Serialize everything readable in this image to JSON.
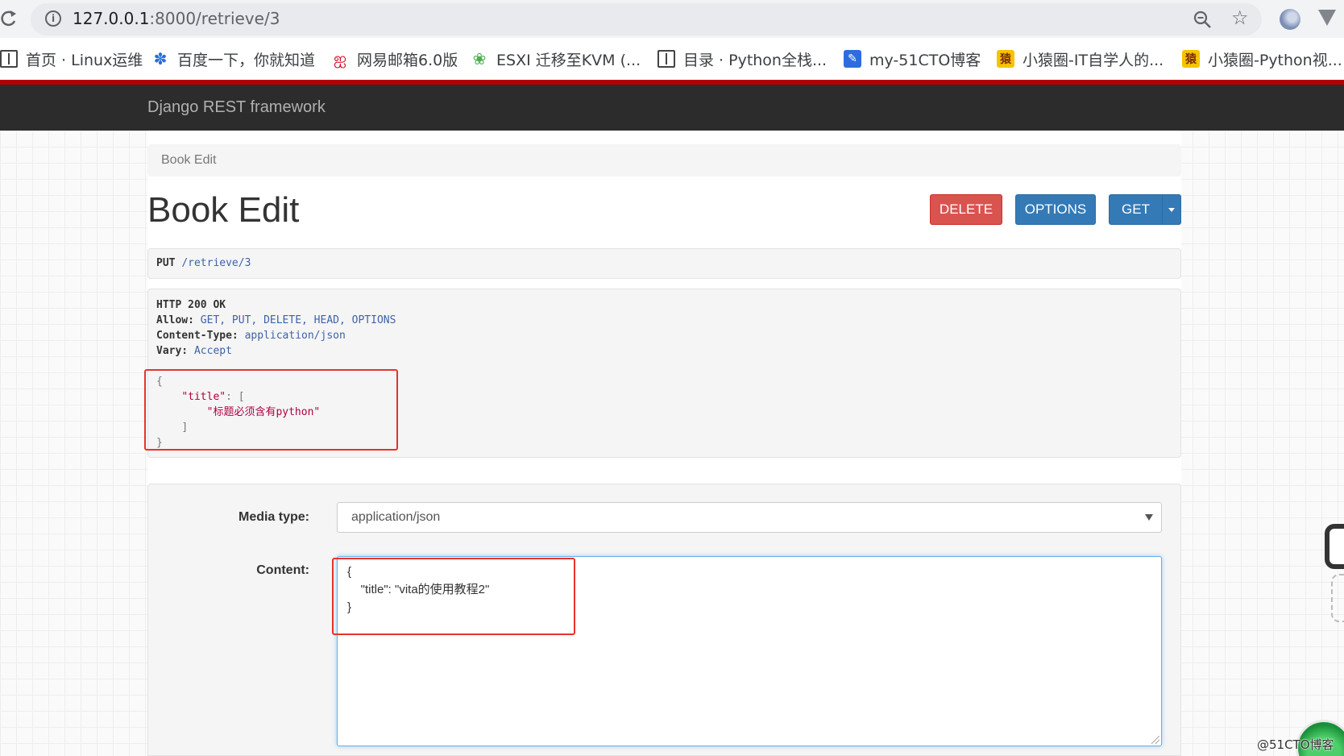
{
  "browser": {
    "url_host": "127.0.0.1",
    "url_rest": ":8000/retrieve/3",
    "bookmarks": [
      {
        "label": "首页 · Linux运维",
        "icon": "book-icon"
      },
      {
        "label": "百度一下，你就知道",
        "icon": "paw-icon"
      },
      {
        "label": "网易邮箱6.0版",
        "icon": "netease-icon"
      },
      {
        "label": "ESXI 迁移至KVM (...",
        "icon": "frog-icon"
      },
      {
        "label": "目录 · Python全栈...",
        "icon": "book-icon"
      },
      {
        "label": "my-51CTO博客",
        "icon": "feather-icon"
      },
      {
        "label": "小猿圈-IT自学人的...",
        "icon": "ape-icon"
      },
      {
        "label": "小猿圈-Python视...",
        "icon": "ape-icon"
      }
    ]
  },
  "navbar": {
    "brand": "Django REST framework"
  },
  "breadcrumb": "Book Edit",
  "page_title": "Book Edit",
  "buttons": {
    "delete": "DELETE",
    "options": "OPTIONS",
    "get": "GET"
  },
  "request": {
    "method": "PUT",
    "path": "/retrieve/3"
  },
  "response": {
    "status": "HTTP 200 OK",
    "allow_label": "Allow:",
    "allow_value": "GET, PUT, DELETE, HEAD, OPTIONS",
    "content_type_label": "Content-Type:",
    "content_type_value": "application/json",
    "vary_label": "Vary:",
    "vary_value": "Accept",
    "body": {
      "open": "{",
      "key": "\"title\"",
      "colon": ": [",
      "message": "\"标题必须含有python\"",
      "close_bracket": "]",
      "close": "}"
    }
  },
  "form": {
    "media_type_label": "Media type:",
    "media_type_value": "application/json",
    "content_label": "Content:",
    "content_value": "{\n    \"title\": \"vita的使用教程2\"\n}"
  },
  "watermark": "@51CTO博客",
  "colors": {
    "accent_red": "#b20000",
    "navbar": "#2c2c2c",
    "delete": "#d9534f",
    "primary": "#337ab7",
    "highlight_box": "#e6332a"
  }
}
